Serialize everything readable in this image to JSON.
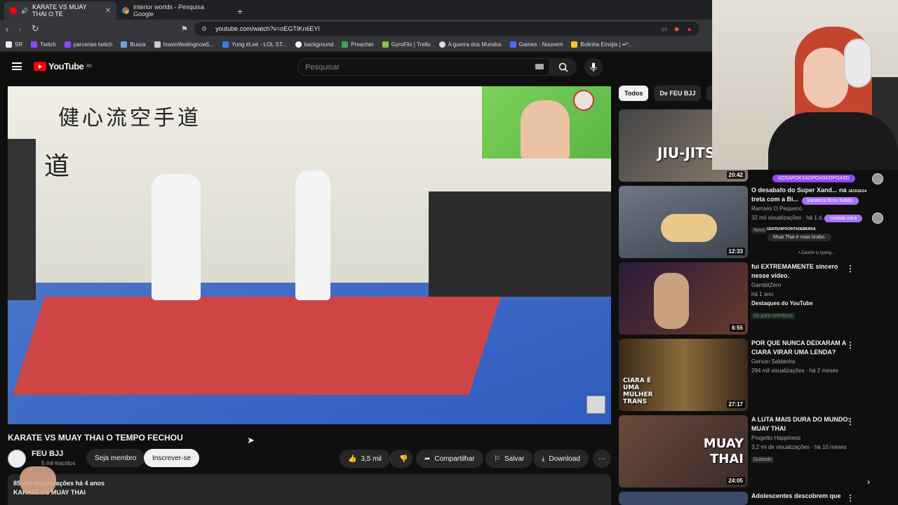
{
  "browser": {
    "tabs": [
      {
        "label": "KARATE VS MUAY THAI O TE",
        "active": true
      },
      {
        "label": "interior worlds - Pesquisa Google",
        "active": false
      }
    ],
    "url": "youtube.com/watch?v=oEGTIKn6EYI",
    "bookmarks": [
      "SR",
      "Twitch",
      "parcerias twitch",
      "Busca",
      "howimfeelingnow5...",
      "Yung #Lee - LOL ST...",
      "background",
      "Preacher",
      "GyroFlix | Trello",
      "A guerra dos Mundos",
      "Games - Nuuvem",
      "Bolinha Emojis | ••*..."
    ]
  },
  "youtube": {
    "logo": "YouTube",
    "logo_region": "BR",
    "search_placeholder": "Pesquisar"
  },
  "video": {
    "kanji": "健心流空手道",
    "title": "KARATE VS MUAY THAI O TEMPO FECHOU",
    "channel": "FEU BJJ",
    "subscribers": "5 mil inscritos",
    "join_label": "Seja membro",
    "subscribe_label": "Inscrever-se",
    "likes": "3,5 mil",
    "share_label": "Compartilhar",
    "save_label": "Salvar",
    "download_label": "Download",
    "desc_line1": "85 mil visualizações  há 4 anos",
    "desc_line2": "KARATE VS MUAY THAI"
  },
  "chips": [
    "Todos",
    "De FEU BJJ",
    "M"
  ],
  "recommendations": [
    {
      "duration": "20:42",
      "overlay": "JIU-JITSU"
    },
    {
      "duration": "12:33",
      "title": "O desabafo do Super Xand... na treta com a Bi...",
      "channel": "Ramsés O Pequeno",
      "meta": "32 mil visualizações · há 1 d...",
      "badge": "Novo"
    },
    {
      "duration": "6:55",
      "title": "fui EXTREMAMENTE sincero nesse vídeo.",
      "channel": "GambitZero",
      "meta": "há 1 ano",
      "meta2": "Destaques do YouTube",
      "badge": "Só para membros"
    },
    {
      "duration": "27:17",
      "title": "POR QUE NUNCA DEIXARAM A CIARA VIRAR UMA LENDA?",
      "channel": "Gerson Saldanha",
      "meta": "294 mil visualizações · há 2 meses",
      "overlay": "CIARA É UMA MULHER TRANS"
    },
    {
      "duration": "24:05",
      "title": "A LUTA MAIS DURA DO MUNDO: MUAY THAI",
      "channel": "Progetto Happiness",
      "meta": "3,2 mi de visualizações · há 10 meses",
      "badge": "Dublado",
      "overlay": "MUAY THAI"
    },
    {
      "title": "Adolescentes descobrem que"
    }
  ],
  "twitch_chat": [
    {
      "text": "KDSAPOKSADPOASKDPOASD",
      "style": "purple"
    },
    {
      "text": "karateca ficou fudido",
      "style": "purple2",
      "name": "JACKSU14"
    },
    {
      "text": "coitado cara",
      "style": "purple2"
    },
    {
      "text": "Muai Thai é mais brabo.",
      "style": "dark",
      "name": "GENTEHIPOCRITADEMERDA"
    },
    {
      "text": "Zaishin is typing...",
      "style": "typing"
    }
  ]
}
